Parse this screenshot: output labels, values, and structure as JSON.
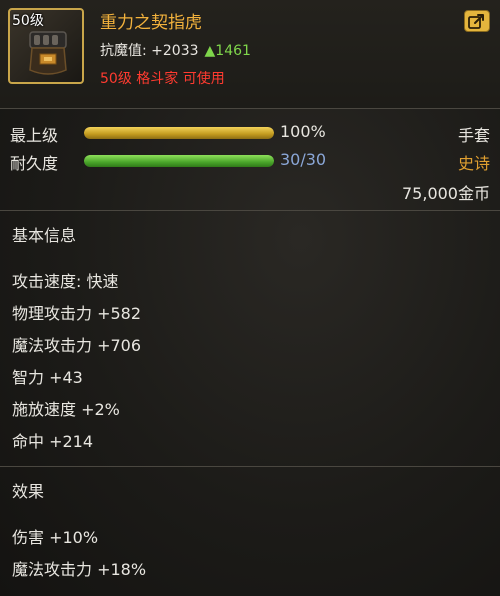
{
  "item": {
    "level_tag": "50级",
    "name": "重力之契指虎",
    "resist_label": "抗魔值: +2033",
    "resist_delta": "▲1461",
    "requirement": "50级 格斗家 可使用",
    "slot": "手套",
    "rarity": "史诗",
    "price": "75,000金币"
  },
  "bars": {
    "upgrade": {
      "label": "最上级",
      "value_text": "100%",
      "fraction": 1.0
    },
    "durability": {
      "label": "耐久度",
      "value_text": "30/30",
      "fraction": 1.0
    }
  },
  "basic_info": {
    "title": "基本信息",
    "lines": [
      "攻击速度: 快速",
      "物理攻击力 +582",
      "魔法攻击力 +706",
      "智力 +43",
      "施放速度 +2%",
      "命中 +214"
    ]
  },
  "effects": {
    "title": "效果",
    "lines": [
      "伤害 +10%",
      "魔法攻击力 +18%"
    ]
  },
  "icons": {
    "share": "share-icon",
    "item": "knuckle-weapon-icon"
  },
  "colors": {
    "name": "#f3b23c",
    "requirement": "#ff3b30",
    "delta": "#7fd64b",
    "rarity": "#e0a030",
    "frame": "#c9a64a"
  }
}
